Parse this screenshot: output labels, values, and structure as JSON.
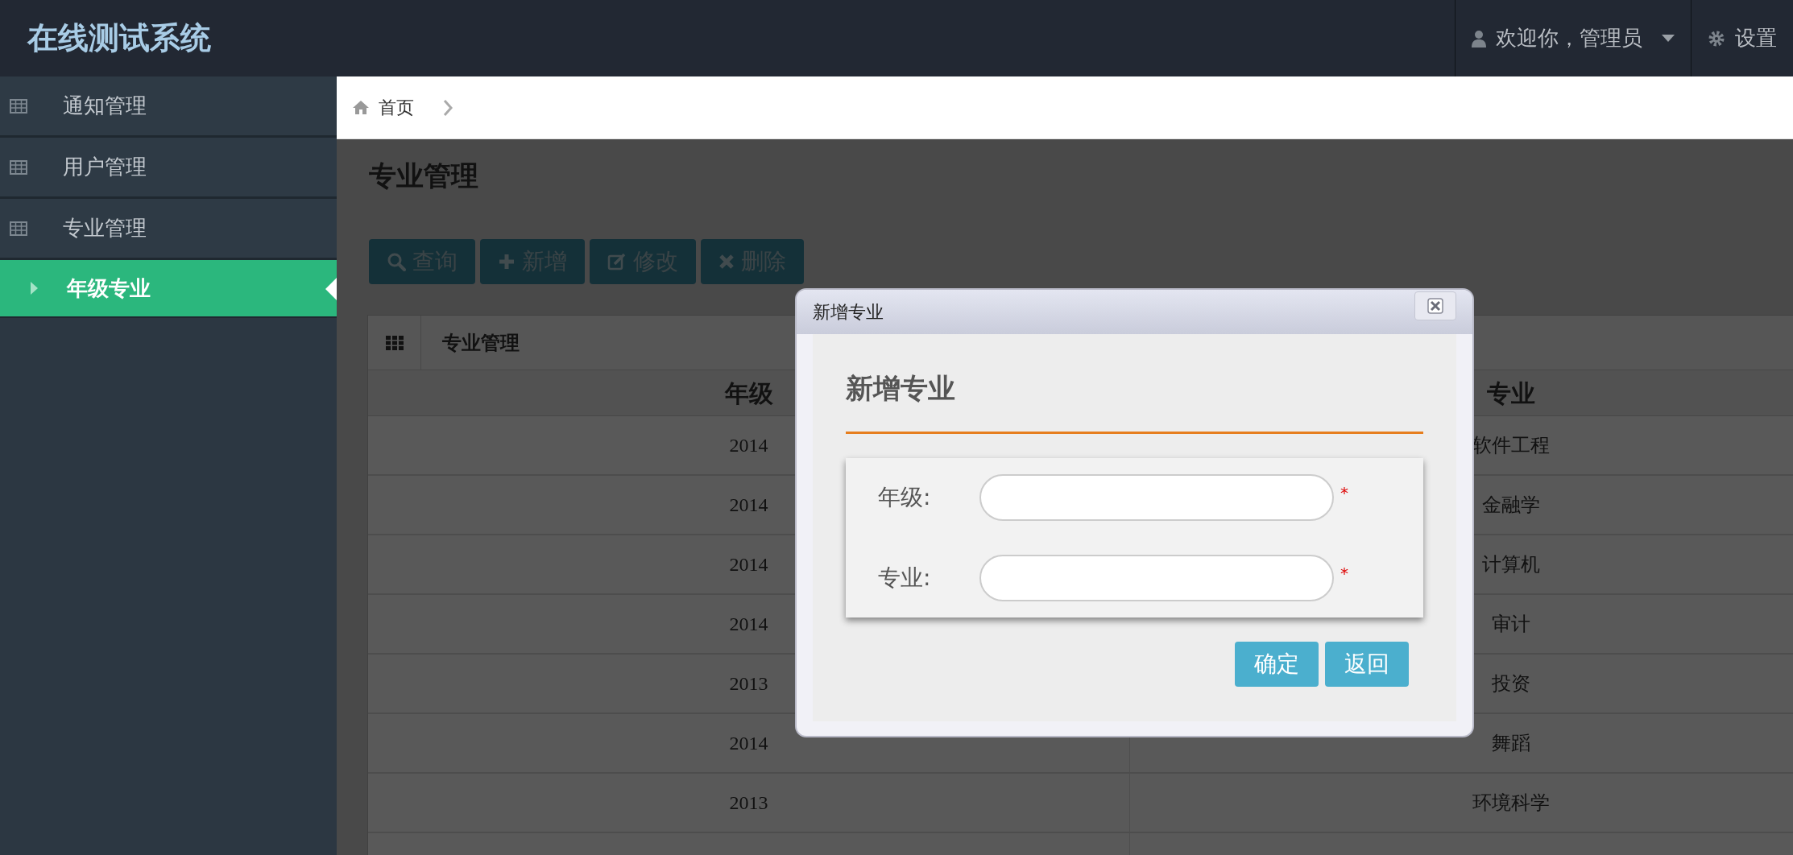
{
  "header": {
    "title": "在线测试系统",
    "user": "欢迎你，管理员",
    "settings": "设置"
  },
  "sidebar": {
    "items": [
      {
        "label": "通知管理",
        "selected": false
      },
      {
        "label": "用户管理",
        "selected": false
      },
      {
        "label": "专业管理",
        "selected": false,
        "children": [
          {
            "label": "年级专业",
            "selected": true
          }
        ]
      }
    ]
  },
  "breadcrumb": [
    "首页"
  ],
  "page_title": "专业管理",
  "toolbar": [
    {
      "kind": "search",
      "label": "查询"
    },
    {
      "kind": "add",
      "label": "新增"
    },
    {
      "kind": "edit",
      "label": "修改"
    },
    {
      "kind": "delete",
      "label": "删除"
    }
  ],
  "panel_title": "专业管理",
  "table": {
    "columns": [
      "年级",
      "专业"
    ],
    "rows": [
      [
        "2014",
        "软件工程"
      ],
      [
        "2014",
        "金融学"
      ],
      [
        "2014",
        "计算机"
      ],
      [
        "2014",
        "审计"
      ],
      [
        "2013",
        "投资"
      ],
      [
        "2014",
        "舞蹈"
      ],
      [
        "2013",
        "环境科学"
      ]
    ]
  },
  "dialog": {
    "title": "新增专业",
    "heading": "新增专业",
    "fields": [
      {
        "label": "年级:",
        "required_mark": "*"
      },
      {
        "label": "专业:",
        "required_mark": "*"
      }
    ],
    "buttons": [
      "确定",
      "返回"
    ]
  }
}
